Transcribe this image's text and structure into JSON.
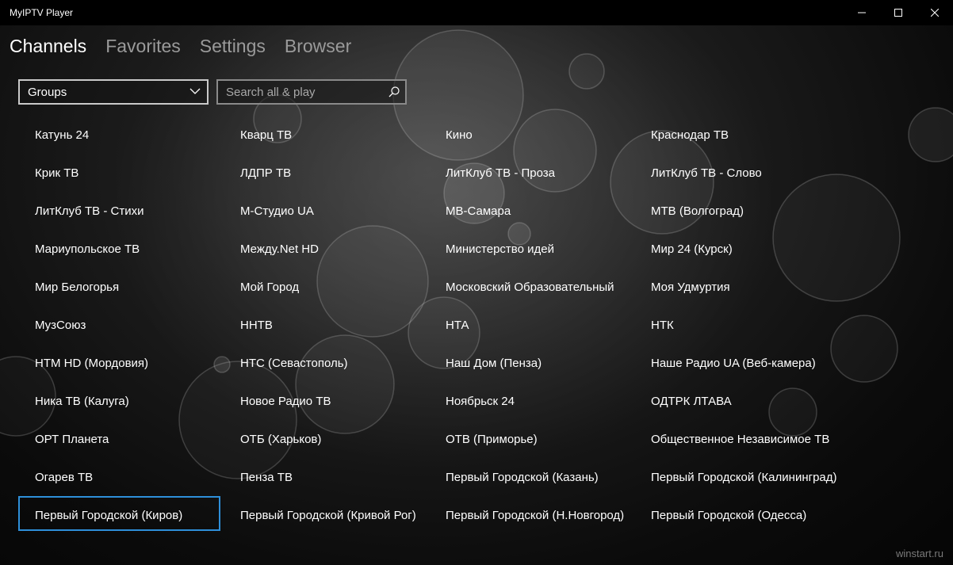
{
  "window": {
    "title": "MyIPTV Player"
  },
  "nav": {
    "items": [
      {
        "label": "Channels",
        "active": true
      },
      {
        "label": "Favorites",
        "active": false
      },
      {
        "label": "Settings",
        "active": false
      },
      {
        "label": "Browser",
        "active": false
      }
    ]
  },
  "controls": {
    "groups_value": "Groups",
    "search_placeholder": "Search all & play"
  },
  "channels": [
    "Катунь 24",
    "Кварц ТВ",
    "Кино",
    "Краснодар ТВ",
    "Крик ТВ",
    "ЛДПР ТВ",
    "ЛитКлуб ТВ - Проза",
    "ЛитКлуб ТВ - Слово",
    "ЛитКлуб ТВ - Стихи",
    "М-Студио UA",
    "МВ-Самара",
    "МТВ (Волгоград)",
    "Мариупольское ТВ",
    "Между.Net HD",
    "Министерство идей",
    "Мир 24 (Курск)",
    "Мир Белогорья",
    "Мой Город",
    "Московский Образовательный",
    "Моя Удмуртия",
    "МузСоюз",
    "ННТВ",
    "НТА",
    "НТК",
    "НТМ HD (Мордовия)",
    "НТС (Севастополь)",
    "Наш Дом (Пенза)",
    "Наше Радио UA (Веб-камера)",
    "Ника ТВ (Калуга)",
    "Новое Радио ТВ",
    "Ноябрьск 24",
    "ОДТРК ЛТАВА",
    "ОРТ Планета",
    "ОТБ (Харьков)",
    "ОТВ (Приморье)",
    "Общественное Независимое ТВ",
    "Огарев ТВ",
    "Пенза ТВ",
    "Первый Городской (Казань)",
    "Первый Городской (Калининград)",
    "Первый Городской (Киров)",
    "Первый Городской (Кривой Рог)",
    "Первый Городской (Н.Новгород)",
    "Первый Городской (Одесса)"
  ],
  "focused_channel": "Первый Городской (Киров)",
  "watermark": "winstart.ru",
  "colors": {
    "focus_border": "#2e8fd9",
    "titlebar": "#000000",
    "nav_inactive": "#9a9a9a"
  },
  "icons": {
    "minimize": "minimize-icon",
    "maximize": "maximize-icon",
    "close": "close-icon",
    "dropdown": "chevron-down-icon",
    "search": "search-icon"
  }
}
